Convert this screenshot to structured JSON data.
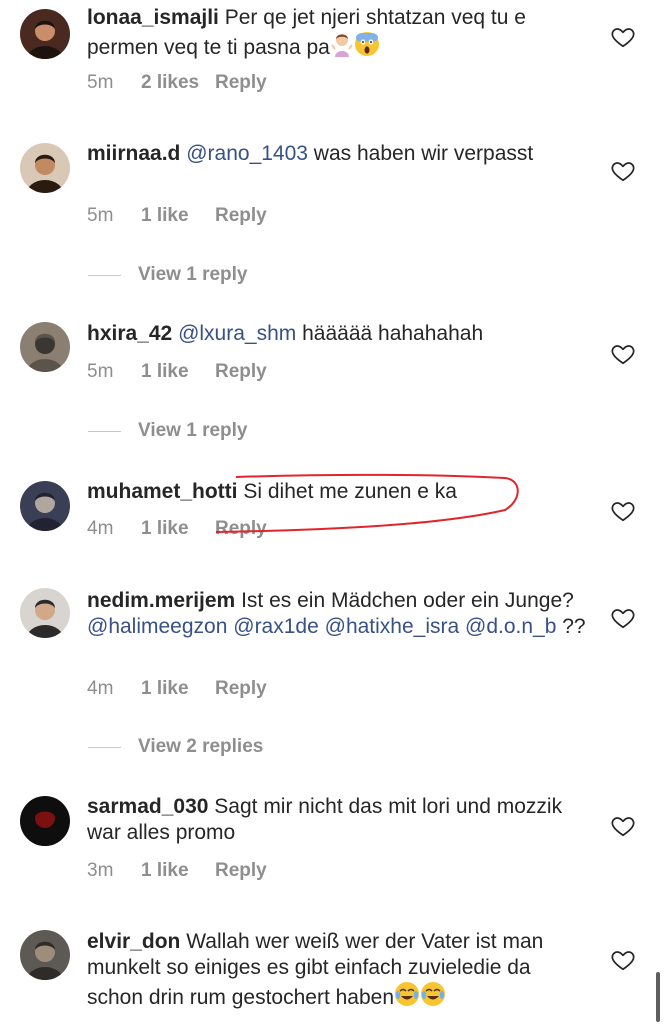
{
  "comments": [
    {
      "username": "lonaa_ismajli",
      "segments": [
        {
          "t": "Per qe jet njeri shtatzan veq tu e permen veq te ti pasna pa",
          "m": false
        }
      ],
      "trailing_emojis": [
        "person-shrugging-emoji",
        "screaming-face-emoji"
      ],
      "time": "5m",
      "likes": "2 likes",
      "reply": "Reply",
      "view_replies": null,
      "avatar": {
        "bg": "#4a2a20",
        "face": "#c98d6a",
        "hair": "#1e120e"
      }
    },
    {
      "username": "miirnaa.d",
      "segments": [
        {
          "t": "@rano_1403",
          "m": true
        },
        {
          "t": " was haben wir verpasst",
          "m": false
        }
      ],
      "trailing_emojis": [],
      "time": "5m",
      "likes": "1 like",
      "reply": "Reply",
      "view_replies": "View 1 reply",
      "avatar": {
        "bg": "#d9c8b6",
        "face": "#c08a62",
        "hair": "#2a1a10"
      }
    },
    {
      "username": "hxira_42",
      "segments": [
        {
          "t": "@lxura_shm",
          "m": true
        },
        {
          "t": " häääää hahahahah",
          "m": false
        }
      ],
      "trailing_emojis": [],
      "time": "5m",
      "likes": "1 like",
      "reply": "Reply",
      "view_replies": "View 1 reply",
      "avatar": {
        "bg": "#8a7f70",
        "face": "#3a3632",
        "hair": "#5c544a"
      }
    },
    {
      "username": "muhamet_hotti",
      "segments": [
        {
          "t": "Si dihet me zunen e ka",
          "m": false
        }
      ],
      "trailing_emojis": [],
      "time": "4m",
      "likes": "1 like",
      "reply": "Reply",
      "view_replies": null,
      "avatar": {
        "bg": "#3b3f55",
        "face": "#b0a6a0",
        "hair": "#222233"
      }
    },
    {
      "username": "nedim.merijem",
      "segments": [
        {
          "t": "Ist es ein Mädchen oder ein Junge? ",
          "m": false
        },
        {
          "t": "@halimeegzon",
          "m": true
        },
        {
          "t": " ",
          "m": false
        },
        {
          "t": "@rax1de",
          "m": true
        },
        {
          "t": " ",
          "m": false
        },
        {
          "t": "@hatixhe_isra",
          "m": true
        },
        {
          "t": " ",
          "m": false
        },
        {
          "t": "@d.o.n_b",
          "m": true
        },
        {
          "t": " ??",
          "m": false
        }
      ],
      "trailing_emojis": [],
      "time": "4m",
      "likes": "1 like",
      "reply": "Reply",
      "view_replies": "View 2 replies",
      "avatar": {
        "bg": "#d8d4cf",
        "face": "#d2a88a",
        "hair": "#2b2b2b"
      }
    },
    {
      "username": "sarmad_030",
      "segments": [
        {
          "t": "Sagt mir nicht das mit lori und mozzik war alles promo",
          "m": false
        }
      ],
      "trailing_emojis": [],
      "time": "3m",
      "likes": "1 like",
      "reply": "Reply",
      "view_replies": null,
      "avatar": {
        "bg": "#0e0e0e",
        "face": "#7a1010",
        "hair": "#0e0e0e"
      }
    },
    {
      "username": "elvir_don",
      "segments": [
        {
          "t": "Wallah wer weiß wer der Vater ist man munkelt so einiges es gibt einfach zuvieledie da schon drin rum gestochert haben",
          "m": false
        }
      ],
      "trailing_emojis": [
        "tears-of-joy-emoji",
        "tears-of-joy-emoji"
      ],
      "time": "",
      "likes": "",
      "reply": "",
      "view_replies": null,
      "avatar": {
        "bg": "#5d5a55",
        "face": "#9e8d7a",
        "hair": "#2e2b28"
      }
    }
  ],
  "colors": {
    "text": "#262626",
    "secondary": "#8e8e8e",
    "mention": "#385185",
    "markup": "#e0262c"
  }
}
